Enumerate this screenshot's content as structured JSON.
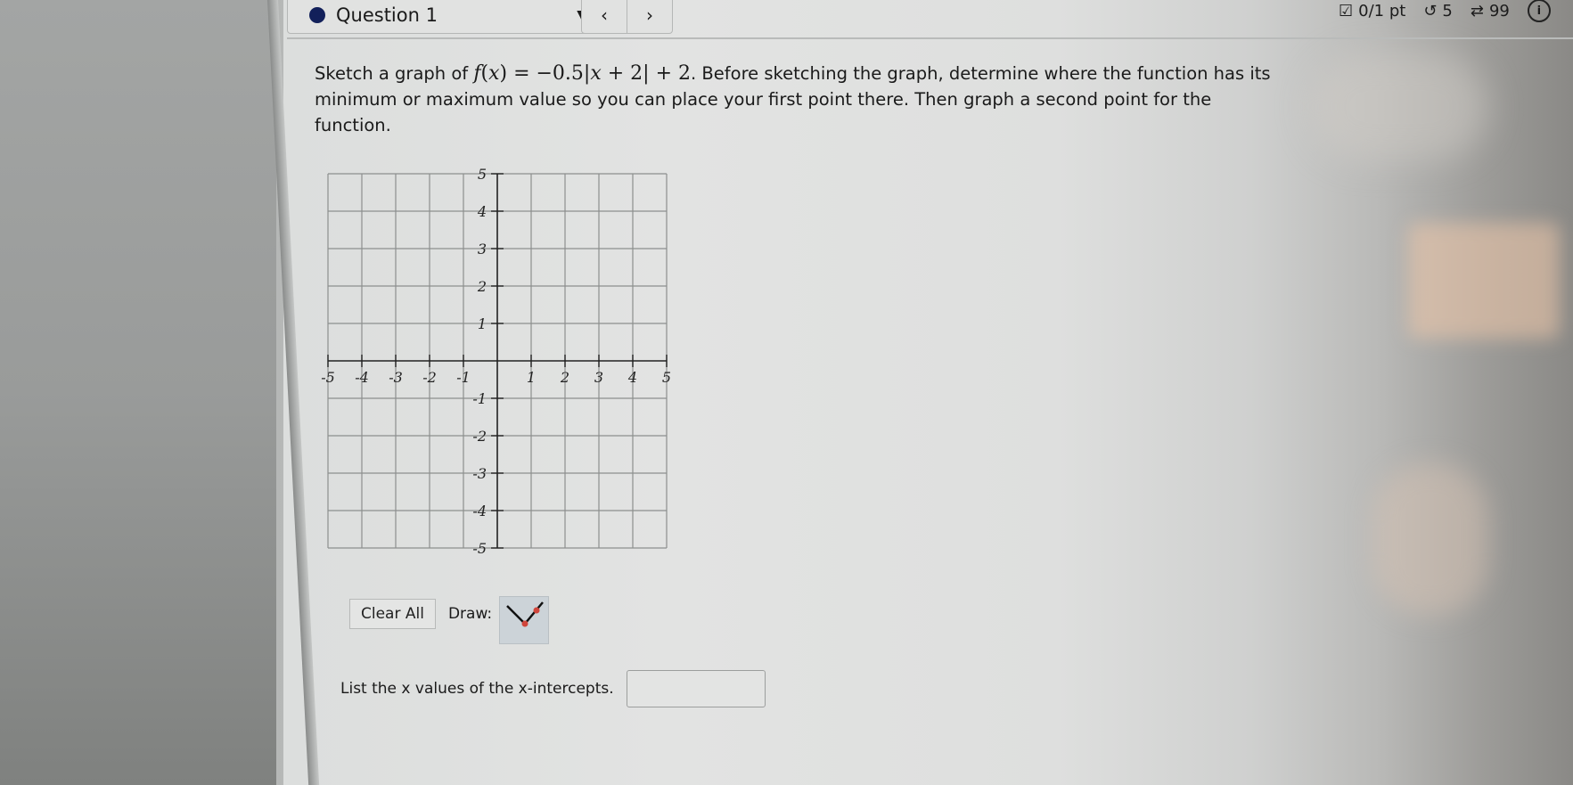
{
  "header": {
    "question_label": "Question 1",
    "dropdown_caret": "▼",
    "prev": "‹",
    "next": "›",
    "score": "0/1 pt",
    "retries": "5",
    "attempts": "99",
    "info": "i"
  },
  "prompt": {
    "lead": "Sketch a graph of ",
    "math_f": "f",
    "math_x": "x",
    "math_rest_a": ") = −0.5|",
    "math_rest_b": " + 2| + 2",
    "rest": ". Before sketching the graph, determine where the function has its minimum or maximum value so you can place your first point there. Then graph a second point for the function."
  },
  "graph": {
    "x_range": [
      -5,
      5
    ],
    "y_range": [
      -5,
      5
    ],
    "x_ticks": [
      "-5",
      "-4",
      "-3",
      "-2",
      "-1",
      "1",
      "2",
      "3",
      "4",
      "5"
    ],
    "y_ticks": [
      "5",
      "4",
      "3",
      "2",
      "1",
      "-1",
      "-2",
      "-3",
      "-4",
      "-5"
    ]
  },
  "tools": {
    "clear_all": "Clear All",
    "draw_label": "Draw:",
    "draw_tool_name": "absolute value"
  },
  "answer": {
    "label": "List the x values of the x-intercepts.",
    "value": "",
    "placeholder": ""
  },
  "colors": {
    "question_dot": "#12205a",
    "tool_point": "#d0453b",
    "tool_bg": "#ccd3d8"
  }
}
